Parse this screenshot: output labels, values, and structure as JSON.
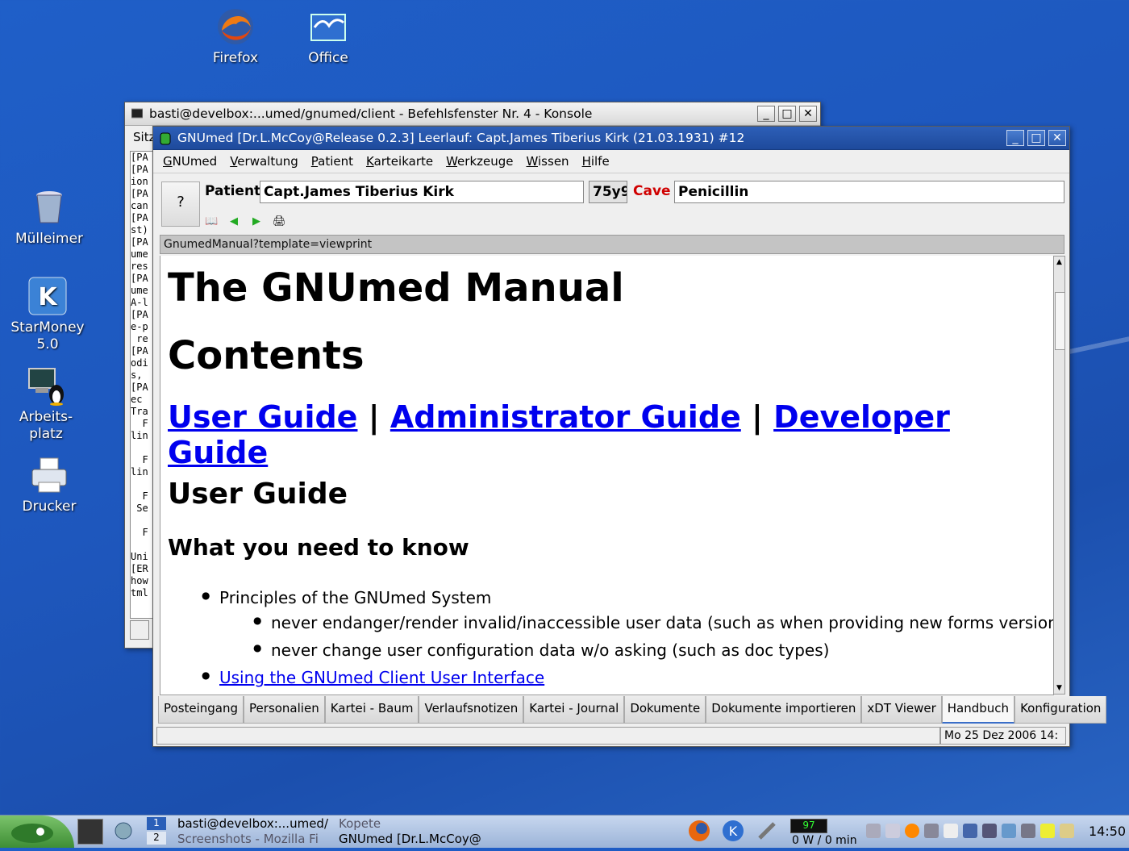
{
  "desktop": {
    "icons": [
      {
        "label": "Firefox"
      },
      {
        "label": "Office"
      },
      {
        "label": "Mülleimer"
      },
      {
        "label": "StarMoney\n5.0"
      },
      {
        "label": "Arbeits-\nplatz"
      },
      {
        "label": "Drucker"
      }
    ]
  },
  "konsole": {
    "title": "basti@develbox:...umed/gnumed/client - Befehlsfenster Nr. 4 - Konsole",
    "menu_first": "Sitz",
    "lines": [
      "[PA",
      "[PA",
      "ion",
      "[PA",
      "can",
      "[PA",
      "st)",
      "[PA",
      "ume",
      "res",
      "[PA",
      "ume",
      "A-l",
      "[PA",
      "e-p",
      " re",
      "[PA",
      "odi",
      "s,",
      "[PA",
      "ec",
      "Tra",
      "  F",
      "lin",
      "",
      "  F",
      "lin",
      "",
      "  F",
      " Se",
      "",
      "  F",
      "",
      "Uni",
      "[ER",
      "how",
      "tml"
    ]
  },
  "gnumed": {
    "title": "GNUmed [Dr.L.McCoy@Release 0.2.3] Leerlauf: Capt.James Tiberius Kirk (21.03.1931) #12",
    "menu": [
      {
        "u": "G",
        "rest": "NUmed"
      },
      {
        "u": "V",
        "rest": "erwaltung"
      },
      {
        "u": "P",
        "rest": "atient"
      },
      {
        "u": "K",
        "rest": "arteikarte"
      },
      {
        "u": "W",
        "rest": "erkzeuge"
      },
      {
        "u": "W",
        "rest": "issen"
      },
      {
        "u": "H",
        "pre": "",
        "rest": "ilfe"
      }
    ],
    "question": "?",
    "patient_label": "Patient",
    "patient_name": "Capt.James Tiberius Kirk",
    "age": "75y9",
    "cave_label": "Cave",
    "cave_value": "Penicillin",
    "url": "GnumedManual?template=viewprint",
    "doc": {
      "h1_manual": "The GNUmed Manual",
      "h1_contents": "Contents",
      "link_user": "User Guide",
      "link_admin": "Administrator Guide",
      "link_dev": "Developer Guide",
      "sep": "|",
      "h2_user": "User Guide",
      "h3_know": "What you need to know",
      "li_principles": "Principles of the GNUmed System",
      "li_never1": "never endanger/render invalid/inaccessible user data (such as when providing new forms versions)",
      "li_never2": "never change user configuration data w/o asking (such as doc types)",
      "li_using": "Using the GNUmed Client User Interface"
    },
    "tabs": [
      "Posteingang",
      "Personalien",
      "Kartei - Baum",
      "Verlaufsnotizen",
      "Kartei - Journal",
      "Dokumente",
      "Dokumente importieren",
      "xDT Viewer",
      "Handbuch",
      "Konfiguration"
    ],
    "active_tab": "Handbuch",
    "status_time": "Mo 25 Dez 2006 14:"
  },
  "taskbar": {
    "desktop_num": "1",
    "desktop_num2": "2",
    "task1": "basti@develbox:...umed/",
    "task2": "Kopete",
    "task3": "Screenshots - Mozilla Fi",
    "task4": "GNUmed [Dr.L.McCoy@",
    "battery": "97",
    "power": "0 W / 0 min",
    "clock": "14:50"
  }
}
